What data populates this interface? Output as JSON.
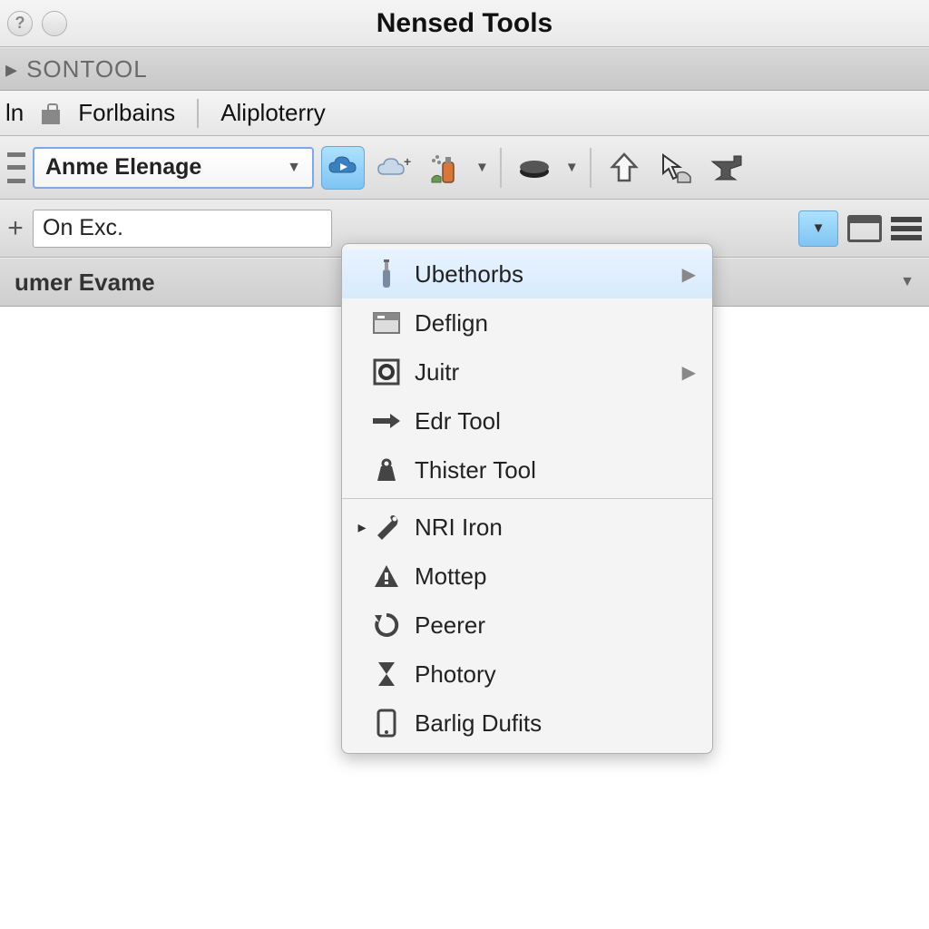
{
  "window": {
    "title": "Nensed Tools"
  },
  "breadcrumb": {
    "label": "SONTOOL"
  },
  "menubar": {
    "item0": "ln",
    "item1": "Forlbains",
    "item2": "Aliploterry"
  },
  "toolbar": {
    "combo_value": "Anme Elenage"
  },
  "toolbar2": {
    "field_value": "On Exc."
  },
  "panel": {
    "title": "umer Evame"
  },
  "menu": {
    "items": [
      {
        "label": "Ubethorbs",
        "icon": "bottle-icon",
        "submenu": true,
        "highlight": true
      },
      {
        "label": "Deflign",
        "icon": "card-icon"
      },
      {
        "label": "Juitr",
        "icon": "square-target-icon",
        "submenu": true
      },
      {
        "label": "Edr Tool",
        "icon": "arrow-right-icon"
      },
      {
        "label": "Thister Tool",
        "icon": "weight-icon"
      }
    ],
    "items2": [
      {
        "label": "NRI Iron",
        "icon": "wrench-icon",
        "indicator": true
      },
      {
        "label": "Mottep",
        "icon": "warning-icon"
      },
      {
        "label": "Peerer",
        "icon": "refresh-icon"
      },
      {
        "label": "Photory",
        "icon": "hourglass-icon"
      },
      {
        "label": "Barlig Dufits",
        "icon": "device-icon"
      }
    ]
  }
}
